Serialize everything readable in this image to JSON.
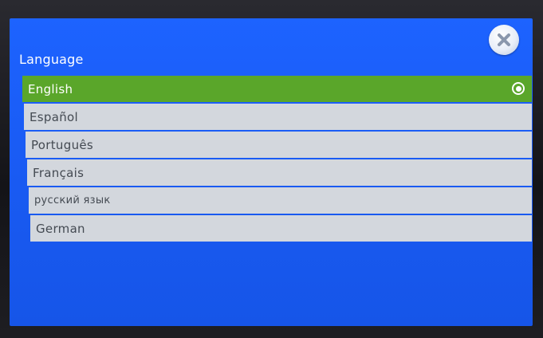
{
  "dialog": {
    "title": "Language",
    "close_icon": "close-icon"
  },
  "languages": [
    {
      "label": "English",
      "selected": true
    },
    {
      "label": "Español",
      "selected": false
    },
    {
      "label": "Português",
      "selected": false
    },
    {
      "label": "Français",
      "selected": false
    },
    {
      "label": "русский язык",
      "selected": false
    },
    {
      "label": "German",
      "selected": false
    }
  ],
  "colors": {
    "background": "#1d63ff",
    "selected_row": "#5aa62a",
    "row": "#d3d7dd",
    "row_text": "#444a52"
  }
}
